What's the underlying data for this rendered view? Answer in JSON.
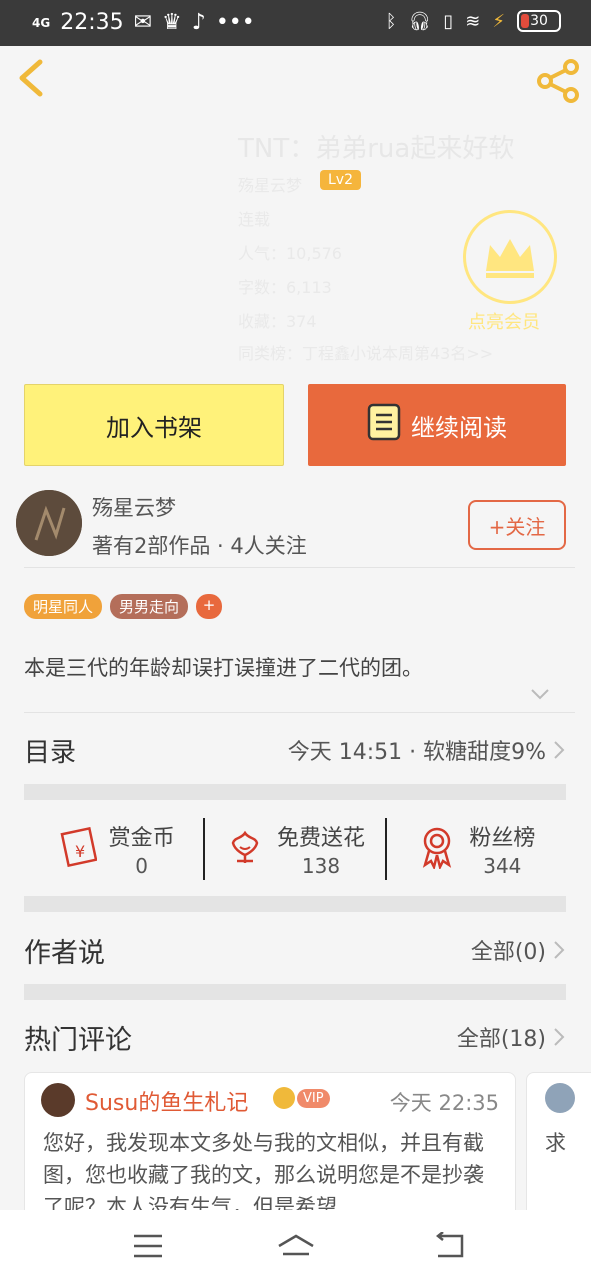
{
  "status_bar": {
    "time": "22:35",
    "network": "4G",
    "battery": "30"
  },
  "book": {
    "title": "TNT：弟弟rua起来好软",
    "author_line": "殇星云梦",
    "level": "Lv2",
    "meta": [
      "连载",
      "人气：10,576",
      "字数：6,113",
      "收藏：374"
    ],
    "related": "同类榜：丁程鑫小说本周第43名>>",
    "vip_label": "点亮会员"
  },
  "actions": {
    "add_shelf": "加入书架",
    "continue_read": "继续阅读"
  },
  "author": {
    "name": "殇星云梦",
    "works": "著有2部作品 · 4人关注",
    "follow": "+关注"
  },
  "tags": [
    "明星同人",
    "男男走向",
    "+"
  ],
  "intro": "本是三代的年龄却误打误撞进了二代的团。",
  "toc": {
    "title": "目录",
    "update": "今天 14:51 · 软糖甜度9%"
  },
  "stats": [
    {
      "label": "赏金币",
      "value": "0",
      "icon": "red-envelope-icon"
    },
    {
      "label": "免费送花",
      "value": "138",
      "icon": "flower-icon"
    },
    {
      "label": "粉丝榜",
      "value": "344",
      "icon": "medal-icon"
    }
  ],
  "author_says": {
    "title": "作者说",
    "all": "全部(0)"
  },
  "hot_comments": {
    "title": "热门评论",
    "all": "全部(18)",
    "items": [
      {
        "name": "Susu的鱼生札记",
        "vip": "VIP",
        "time": "今天 22:35",
        "body": "您好，我发现本文多处与我的文相似，并且有截图，您也收藏了我的文，那么说明您是不是抄袭了呢？本人没有生气，但是希望…"
      },
      {
        "name": "",
        "body": "求"
      }
    ]
  },
  "colors": {
    "accent": "#e8693d",
    "shelf": "#fff27a",
    "gold": "#f0b93a"
  }
}
